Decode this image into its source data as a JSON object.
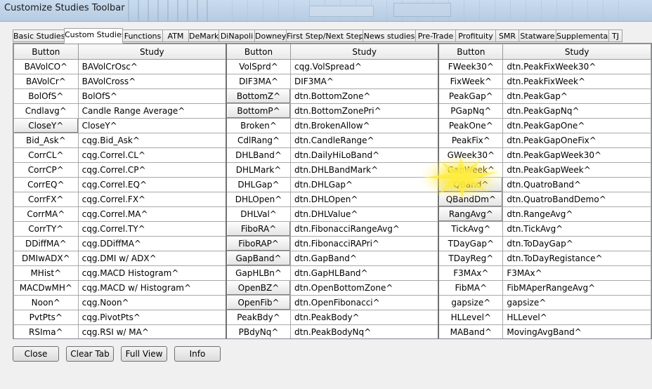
{
  "window": {
    "title": "Customize Studies Toolbar"
  },
  "tabs": [
    "Basic Studies",
    "Custom Studies",
    "Functions",
    "ATM",
    "DeMark",
    "DiNapoli",
    "Downey",
    "First Step/Next Step",
    "News studies",
    "Pre-Trade",
    "Profituity",
    "SMR",
    "Statware",
    "Supplemental",
    "TJ"
  ],
  "active_tab": "Custom Studies",
  "grid": {
    "headers": [
      "Button",
      "Study",
      "Button",
      "Study",
      "Button",
      "Study"
    ],
    "rows": [
      [
        [
          "BAVolCO^",
          "BAVolCrOsc^"
        ],
        [
          "VolSprd^",
          "cqg.VolSpread^"
        ],
        [
          "FWeek30^",
          "dtn.PeakFixWeek30^"
        ]
      ],
      [
        [
          "BAVolCr^",
          "BAVolCross^"
        ],
        [
          "DIF3MA^",
          "DIF3MA^"
        ],
        [
          "FixWeek^",
          "dtn.PeakFixWeek^"
        ]
      ],
      [
        [
          "BolOfS^",
          "BolOfS^"
        ],
        [
          "BottomZ^",
          "dtn.BottomZone^"
        ],
        [
          "PeakGap^",
          "dtn.PeakGap^"
        ]
      ],
      [
        [
          "Cndlavg^",
          "Candle Range Average^"
        ],
        [
          "BottomP^",
          "dtn.BottomZonePri^"
        ],
        [
          "PGapNq^",
          "dtn.PeakGapNq^"
        ]
      ],
      [
        [
          "CloseY^",
          "CloseY^"
        ],
        [
          "Broken^",
          "dtn.BrokenAllow^"
        ],
        [
          "PeakOne^",
          "dtn.PeakGapOne^"
        ]
      ],
      [
        [
          "Bid_Ask^",
          "cqg.Bid_Ask^"
        ],
        [
          "CdlRang^",
          "dtn.CandleRange^"
        ],
        [
          "PeakFix^",
          "dtn.PeakGapOneFix^"
        ]
      ],
      [
        [
          "CorrCL^",
          "cqg.Correl.CL^"
        ],
        [
          "DHLBand^",
          "dtn.DailyHiLoBand^"
        ],
        [
          "GWeek30^",
          "dtn.PeakGapWeek30^"
        ]
      ],
      [
        [
          "CorrCP^",
          "cqg.Correl.CP^"
        ],
        [
          "DHLMark^",
          "dtn.DHLBandMark^"
        ],
        [
          "GapWeek^",
          "dtn.PeakGapWeek^"
        ]
      ],
      [
        [
          "CorrEQ^",
          "cqg.Correl.EQ^"
        ],
        [
          "DHLGap^",
          "dtn.DHLGap^"
        ],
        [
          "QBand^",
          "dtn.QuatroBand^"
        ]
      ],
      [
        [
          "CorrFX^",
          "cqg.Correl.FX^"
        ],
        [
          "DHLOpen^",
          "dtn.DHLOpen^"
        ],
        [
          "QBandDm^",
          "dtn.QuatroBandDemo^"
        ]
      ],
      [
        [
          "CorrMA^",
          "cqg.Correl.MA^"
        ],
        [
          "DHLVal^",
          "dtn.DHLValue^"
        ],
        [
          "RangAvg^",
          "dtn.RangeAvg^"
        ]
      ],
      [
        [
          "CorrTY^",
          "cqg.Correl.TY^"
        ],
        [
          "FiboRA^",
          "dtn.FibonacciRangeAvg^"
        ],
        [
          "TickAvg^",
          "dtn.TickAvg^"
        ]
      ],
      [
        [
          "DDiffMA^",
          "cqg.DDiffMA^"
        ],
        [
          "FiboRAP^",
          "dtn.FibonacciRAPri^"
        ],
        [
          "TDayGap^",
          "dtn.ToDayGap^"
        ]
      ],
      [
        [
          "DMIwADX^",
          "cqg.DMI w/ ADX^"
        ],
        [
          "GapBand^",
          "dtn.GapBand^"
        ],
        [
          "TDayReg^",
          "dtn.ToDayRegistance^"
        ]
      ],
      [
        [
          "MHist^",
          "cqg.MACD Histogram^"
        ],
        [
          "GapHLBn^",
          "dtn.GapHLBand^"
        ],
        [
          "F3MAx^",
          "F3MAx^"
        ]
      ],
      [
        [
          "MACDwMH^",
          "cqg.MACD w/ Histogram^"
        ],
        [
          "OpenBZ^",
          "dtn.OpenBottomZone^"
        ],
        [
          "FibMA^",
          "FibMAperRangeAvg^"
        ]
      ],
      [
        [
          "Noon^",
          "cqg.Noon^"
        ],
        [
          "OpenFib^",
          "dtn.OpenFibonacci^"
        ],
        [
          "gapsize^",
          "gapsize^"
        ]
      ],
      [
        [
          "PvtPts^",
          "cqg.PivotPts^"
        ],
        [
          "PeakBdy^",
          "dtn.PeakBody^"
        ],
        [
          "HLLevel^",
          "HLLevel^"
        ]
      ],
      [
        [
          "RSIma^",
          "cqg.RSI w/ MA^"
        ],
        [
          "PBdyNq^",
          "dtn.PeakBodyNq^"
        ],
        [
          "MABand^",
          "MovingAvgBand^"
        ]
      ]
    ],
    "pressed_buttons": [
      "CloseY^",
      "BottomZ^",
      "BottomP^",
      "FiboRA^",
      "FiboRAP^",
      "GapBand^",
      "OpenBZ^",
      "OpenFib^",
      "QBand^",
      "QBandDm^",
      "RangAvg^"
    ],
    "highlighted_button": "GapWeek^"
  },
  "buttons": {
    "close": "Close",
    "clear_tab": "Clear Tab",
    "full_view": "Full View",
    "info": "Info"
  }
}
